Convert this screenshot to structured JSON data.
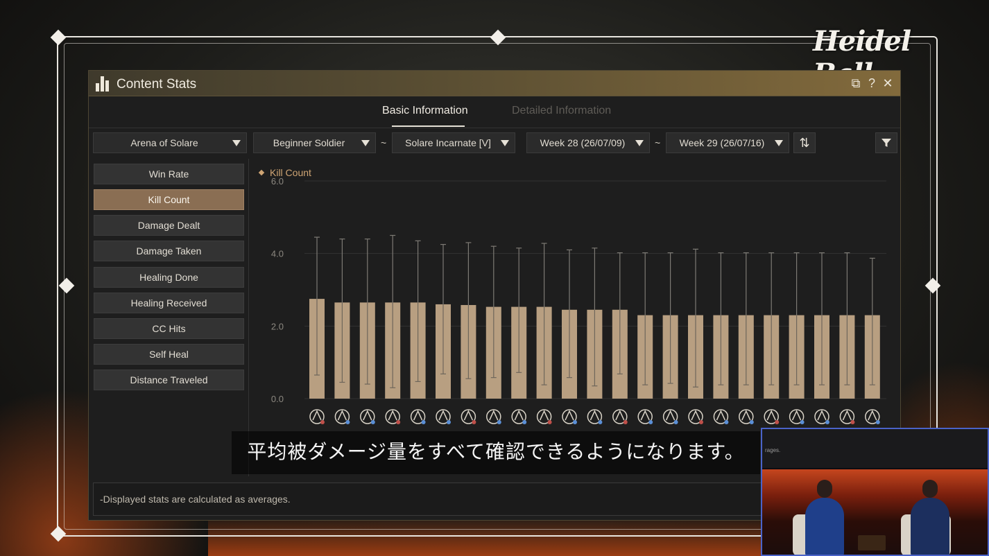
{
  "brand": {
    "logo_text": "Heidel Ball"
  },
  "window": {
    "title": "Content Stats",
    "buttons": {
      "restore": "⧉",
      "help": "?",
      "close": "✕"
    }
  },
  "tabs": [
    {
      "label": "Basic Information",
      "active": true
    },
    {
      "label": "Detailed Information",
      "active": false
    }
  ],
  "filters": {
    "content": "Arena of Solare",
    "rank_from": "Beginner Soldier",
    "rank_to": "Solare Incarnate [V]",
    "week_from": "Week 28 (26/07/09)",
    "week_to": "Week 29 (26/07/16)",
    "range_sep": "~"
  },
  "sidebar": {
    "items": [
      {
        "label": "Win Rate",
        "active": false
      },
      {
        "label": "Kill Count",
        "active": true
      },
      {
        "label": "Damage Dealt",
        "active": false
      },
      {
        "label": "Damage Taken",
        "active": false
      },
      {
        "label": "Healing Done",
        "active": false
      },
      {
        "label": "Healing Received",
        "active": false
      },
      {
        "label": "CC Hits",
        "active": false
      },
      {
        "label": "Self Heal",
        "active": false
      },
      {
        "label": "Distance Traveled",
        "active": false
      }
    ]
  },
  "chart_data": {
    "type": "bar",
    "title": "",
    "xlabel": "",
    "ylabel": "",
    "ylim": [
      0,
      6
    ],
    "y_ticks": [
      "0.0",
      "2.0",
      "4.0",
      "6.0"
    ],
    "grid": true,
    "legend": {
      "position": "top-left"
    },
    "series": [
      {
        "name": "Kill Count",
        "color": "#b89f81",
        "values": [
          2.75,
          2.65,
          2.65,
          2.65,
          2.65,
          2.6,
          2.58,
          2.53,
          2.53,
          2.53,
          2.45,
          2.45,
          2.45,
          2.3,
          2.3,
          2.3,
          2.3,
          2.3,
          2.3,
          2.3,
          2.3,
          2.3,
          2.3
        ],
        "error_high": [
          4.45,
          4.4,
          4.4,
          4.5,
          4.35,
          4.25,
          4.3,
          4.2,
          4.15,
          4.28,
          4.1,
          4.15,
          4.02,
          4.02,
          4.02,
          4.12,
          4.02,
          4.02,
          4.02,
          4.02,
          4.02,
          4.02,
          3.87
        ],
        "error_low": [
          0.65,
          0.45,
          0.4,
          0.3,
          0.47,
          0.68,
          0.55,
          0.58,
          0.72,
          0.38,
          0.58,
          0.35,
          0.68,
          0.38,
          0.42,
          0.32,
          0.38,
          0.38,
          0.38,
          0.38,
          0.38,
          0.38,
          0.38
        ]
      }
    ],
    "category_icons": [
      "class-emblem-icon",
      "class-emblem-icon",
      "class-emblem-icon",
      "class-emblem-icon",
      "class-emblem-icon",
      "class-emblem-icon",
      "class-emblem-icon",
      "class-emblem-icon",
      "class-emblem-icon",
      "class-emblem-icon",
      "class-emblem-icon",
      "class-emblem-icon",
      "class-emblem-icon",
      "class-emblem-icon",
      "class-emblem-icon",
      "class-emblem-icon",
      "class-emblem-icon",
      "class-emblem-icon",
      "class-emblem-icon",
      "class-emblem-icon",
      "class-emblem-icon",
      "class-emblem-icon",
      "class-emblem-icon"
    ]
  },
  "footer": {
    "note": "-Displayed stats are calculated as averages."
  },
  "subtitle": {
    "text": "平均被ダメージ量をすべて確認できるようになります。"
  },
  "pip": {
    "note": "rages."
  },
  "colors": {
    "accent_active": "#8a6e53",
    "bar": "#b89f81",
    "legend": "#cfa574",
    "titlebar": "#826a3c",
    "pip_border": "#4a63c9"
  }
}
